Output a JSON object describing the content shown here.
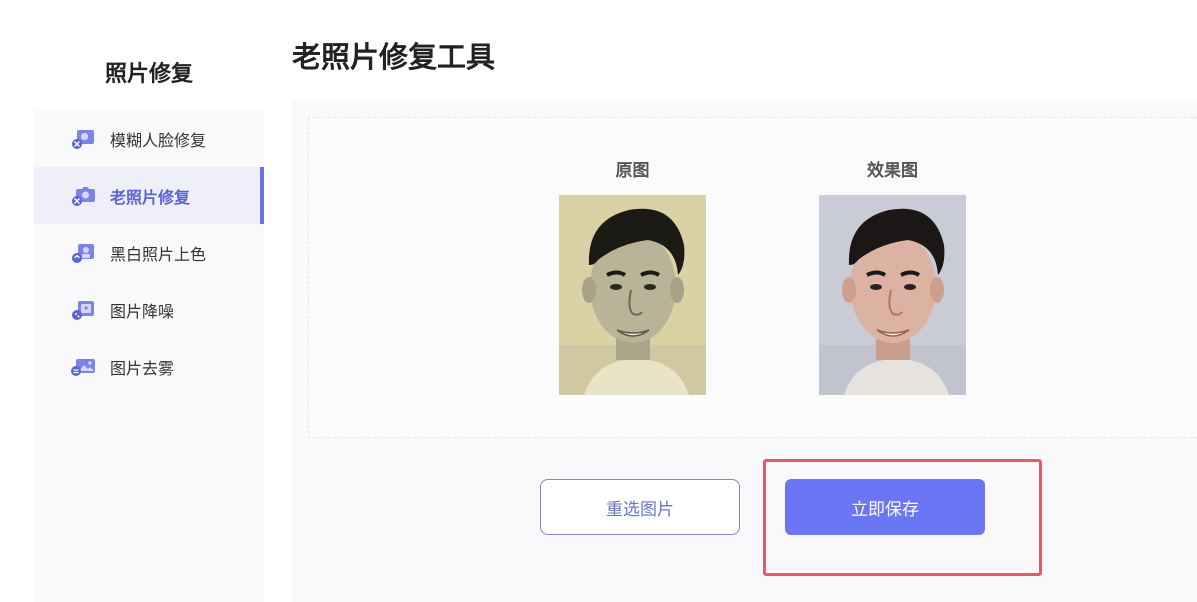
{
  "sidebar": {
    "title": "照片修复",
    "items": [
      {
        "label": "模糊人脸修复",
        "icon": "face-restore-icon",
        "active": false
      },
      {
        "label": "老照片修复",
        "icon": "old-photo-icon",
        "active": true
      },
      {
        "label": "黑白照片上色",
        "icon": "colorize-icon",
        "active": false
      },
      {
        "label": "图片降噪",
        "icon": "denoise-icon",
        "active": false
      },
      {
        "label": "图片去雾",
        "icon": "dehaze-icon",
        "active": false
      }
    ]
  },
  "main": {
    "title": "老照片修复工具",
    "original_label": "原图",
    "result_label": "效果图",
    "reselect_button": "重选图片",
    "save_button": "立即保存"
  },
  "colors": {
    "accent": "#6a76f4",
    "highlight": "#e25a6b"
  }
}
